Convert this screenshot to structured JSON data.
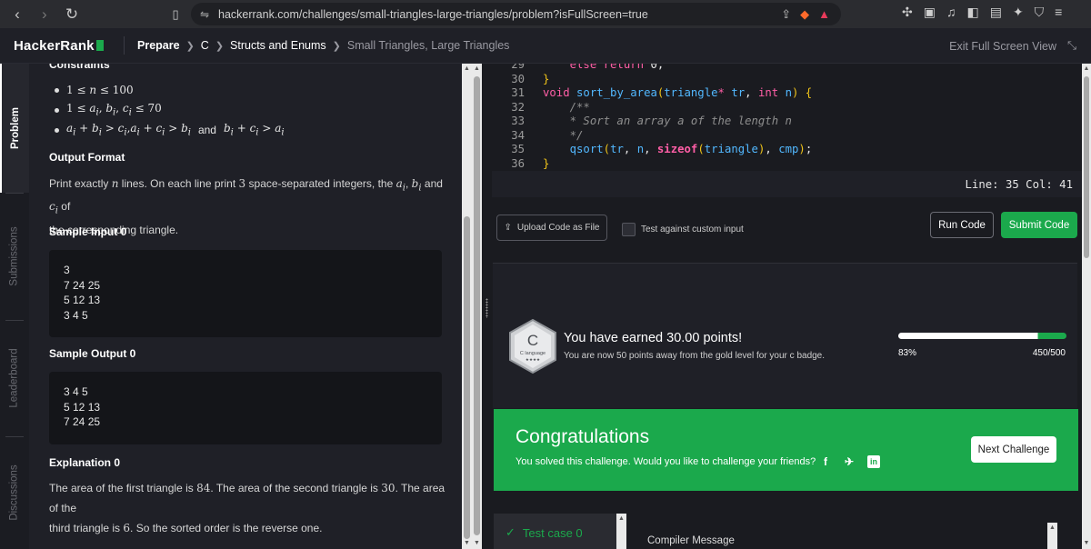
{
  "browser": {
    "url": "hackerrank.com/challenges/small-triangles-large-triangles/problem?isFullScreen=true",
    "brave_count": "2",
    "alert_count": "1"
  },
  "header": {
    "logo": "HackerRank",
    "crumbs": [
      "Prepare",
      "C",
      "Structs and Enums",
      "Small Triangles, Large Triangles"
    ],
    "exit_label": "Exit Full Screen View"
  },
  "side_tabs": [
    "Problem",
    "Submissions",
    "Leaderboard",
    "Discussions"
  ],
  "problem": {
    "constraints_heading": "Constraints",
    "constraint_and": "and",
    "output_heading": "Output Format",
    "output_text_1": "Print exactly",
    "output_text_2": "lines. On each line print",
    "output_text_3": "space-separated integers, the",
    "output_text_4": "and",
    "output_text_5": "of",
    "output_text_6": "the corresponding triangle.",
    "sample_input_heading": "Sample Input 0",
    "sample_input": [
      "3",
      "7 24 25",
      "5 12 13",
      "3 4 5"
    ],
    "sample_output_heading": "Sample Output 0",
    "sample_output": [
      "3 4 5",
      "5 12 13",
      "7 24 25"
    ],
    "explanation_heading": "Explanation 0",
    "expl_1": "The area of the first triangle is",
    "expl_n1": "84",
    "expl_2": ". The area of the second triangle is",
    "expl_n2": "30",
    "expl_3": ". The area of the",
    "expl_4": "third triangle is",
    "expl_n3": "6",
    "expl_5": ". So the sorted order is the reverse one."
  },
  "editor": {
    "line_numbers": [
      "29",
      "30",
      "31",
      "32",
      "33",
      "34",
      "35",
      "36"
    ],
    "status": "Line: 35 Col: 41"
  },
  "actions": {
    "upload": "Upload Code as File",
    "custom_input": "Test against custom input",
    "run": "Run Code",
    "submit": "Submit Code"
  },
  "points": {
    "badge_letter": "C",
    "badge_name": "C language",
    "badge_stars": "★★★★",
    "earned": "You have earned 30.00 points!",
    "sub": "You are now 50 points away from the gold level for your c badge.",
    "progress_percent": 83,
    "percent_label": "83%",
    "points_label": "450/500"
  },
  "congrats": {
    "title": "Congratulations",
    "sub": "You solved this challenge. Would you like to challenge your friends?",
    "next": "Next Challenge"
  },
  "results": {
    "test_case": "Test case 0",
    "compiler": "Compiler Message"
  },
  "colors": {
    "accent": "#1ba94c"
  }
}
